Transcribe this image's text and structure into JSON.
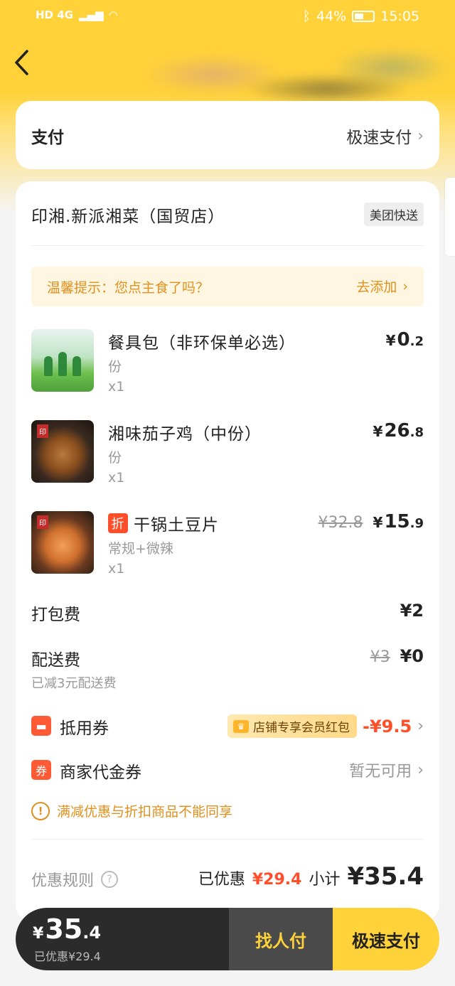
{
  "status_bar": {
    "left": "HD 4G",
    "battery": "44%",
    "time": "15:05"
  },
  "payment": {
    "label": "支付",
    "method": "极速支付"
  },
  "shop": {
    "name": "印湘.新派湘菜（国贸店）",
    "delivery_badge": "美团快送"
  },
  "tip": {
    "text": "温馨提示：您点主食了吗？",
    "action": "去添加"
  },
  "items": [
    {
      "name": "餐具包（非环保单必选）",
      "spec": "份",
      "qty": "x1",
      "price_int": "0",
      "price_dec": ".2",
      "original": ""
    },
    {
      "name": "湘味茄子鸡（中份）",
      "spec": "份",
      "qty": "x1",
      "price_int": "26",
      "price_dec": ".8",
      "original": ""
    },
    {
      "name": "干锅土豆片",
      "spec": "常规+微辣",
      "qty": "x1",
      "price_int": "15",
      "price_dec": ".9",
      "original": "¥32.8",
      "discount_tag": "折"
    }
  ],
  "fees": {
    "packing_label": "打包费",
    "packing_value": "¥2",
    "delivery_label": "配送费",
    "delivery_original": "¥3",
    "delivery_value": "¥0",
    "delivery_note": "已减3元配送费"
  },
  "coupons": {
    "voucher_label": "抵用券",
    "voucher_tag": "店铺专享会员红包",
    "voucher_value": "-¥9.5",
    "merchant_label": "商家代金券",
    "merchant_value": "暂无可用",
    "merchant_icon": "券"
  },
  "warning": "满减优惠与折扣商品不能同享",
  "summary": {
    "rules_label": "优惠规则",
    "discount_label": "已优惠",
    "discount_value": "¥29.4",
    "subtotal_label": "小计",
    "subtotal_value": "¥35.4"
  },
  "bottom": {
    "total_int": "35",
    "total_dec": ".4",
    "total_yen": "¥",
    "discount_note": "已优惠¥29.4",
    "friend_pay": "找人付",
    "fast_pay": "极速支付"
  },
  "colors": {
    "brand_yellow": "#ffd23a",
    "accent_red": "#ff4e2a",
    "tip_orange": "#e0901e"
  }
}
